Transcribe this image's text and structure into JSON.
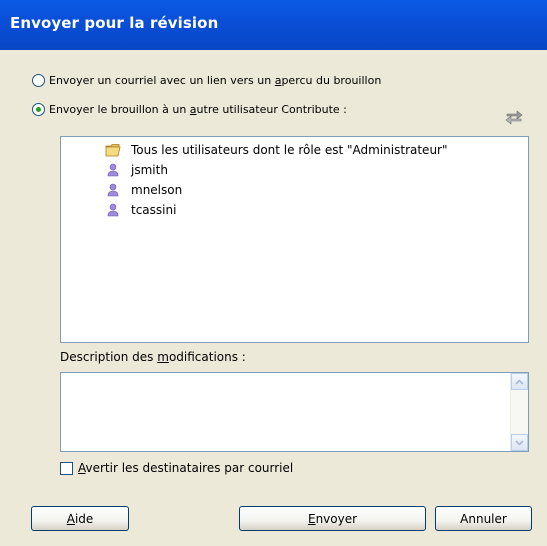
{
  "window": {
    "title": "Envoyer pour la révision"
  },
  "options": {
    "link_pre": "Envoyer un courriel avec un lien vers un ",
    "link_u": "a",
    "link_post": "percu du brouillon",
    "send_pre": "Envoyer le brouillon à un ",
    "send_u": "a",
    "send_post": "utre utilisateur Contribute :",
    "selected": "send"
  },
  "recipients": {
    "group": "Tous les utilisateurs dont le rôle est \"Administrateur\"",
    "users": [
      "jsmith",
      "mnelson",
      "tcassini"
    ]
  },
  "description": {
    "label_pre": "Description des ",
    "label_u": "m",
    "label_post": "odifications :",
    "value": ""
  },
  "notify": {
    "label_u": "A",
    "label_post": "vertir les destinataires par courriel",
    "checked": false
  },
  "buttons": {
    "help_u": "A",
    "help_post": "ide",
    "send_u": "E",
    "send_post": "nvoyer",
    "cancel": "Annuler"
  },
  "icons": {
    "folder": "folder-icon",
    "user": "user-icon",
    "swap": "swap-arrows-icon"
  }
}
